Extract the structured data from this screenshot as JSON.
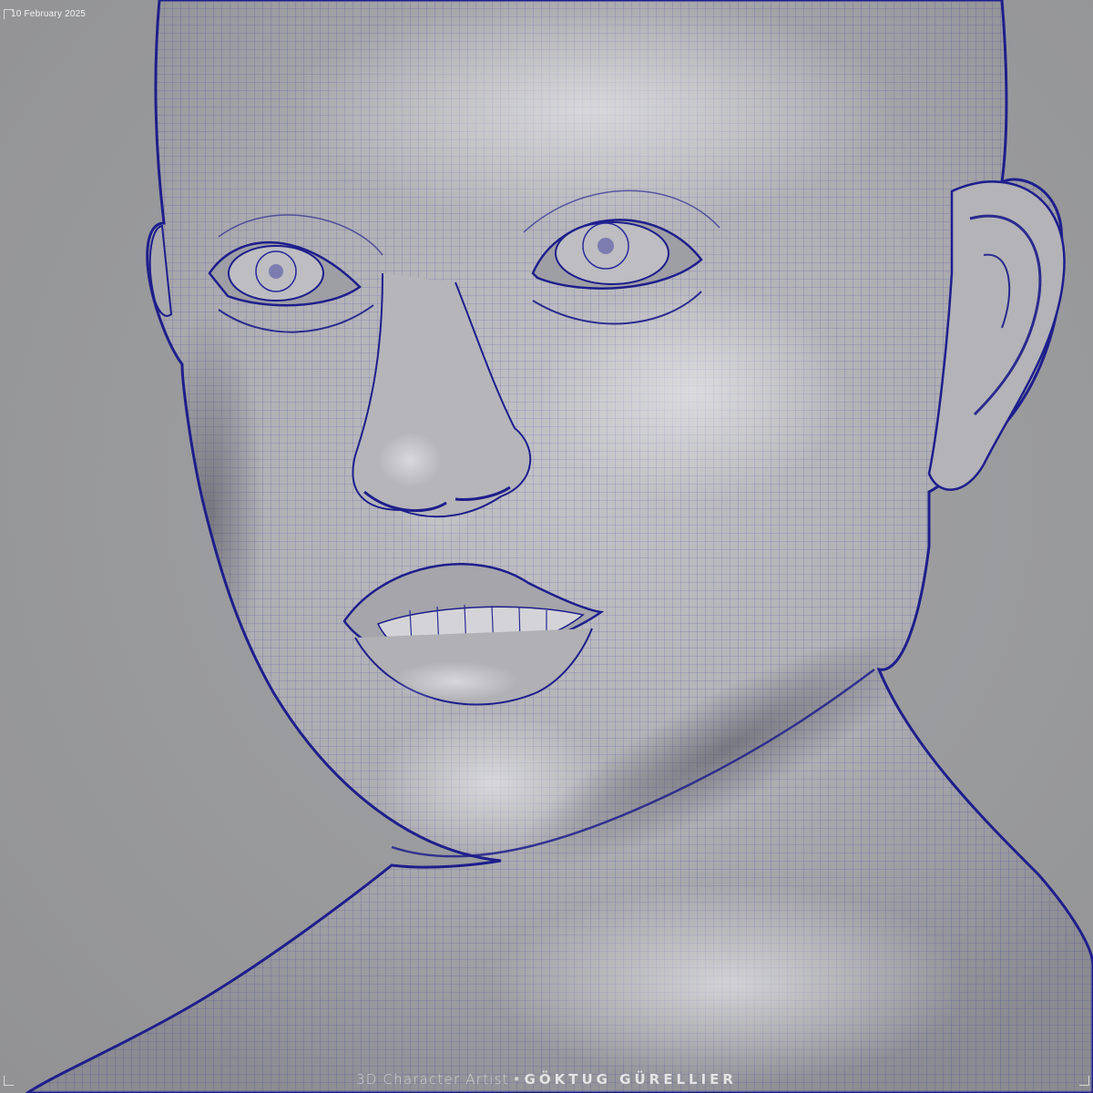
{
  "caption": {
    "date": "10 February 2025",
    "role": "3D Character Artist",
    "separator": "•",
    "artist_name": "GÖKTUG GÜRELLIER"
  },
  "colors": {
    "background": "#9a9a9c",
    "wireframe": "#1e1e8c",
    "skin_shade": "#b9b9bd"
  }
}
